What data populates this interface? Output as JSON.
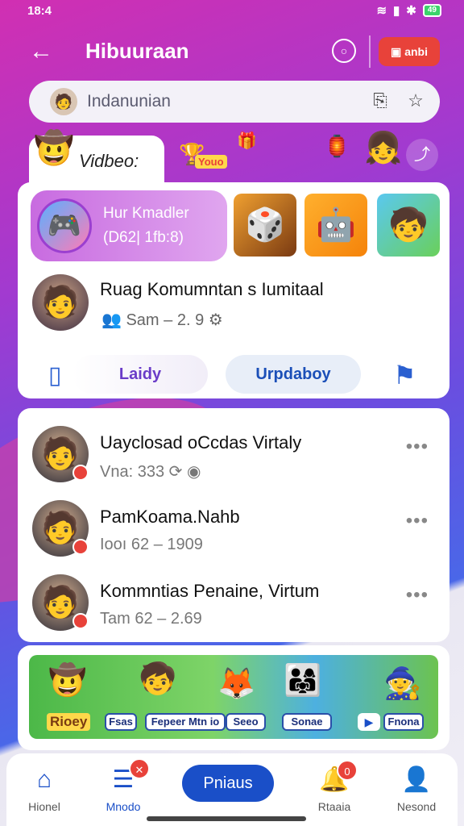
{
  "status": {
    "time": "18:4",
    "battery": "49"
  },
  "header": {
    "title": "Hibuuraan",
    "action_label": "anbi"
  },
  "search": {
    "placeholder": "Indanunian"
  },
  "tabs": {
    "video_label": "Vidbeo:",
    "badge": "Youo"
  },
  "featured": {
    "line1": "Hur Kmadler",
    "line2": "(D62| 1fb:8)"
  },
  "person": {
    "name": "Ruag Komumntan s Iumitaal",
    "sub": "Sam – 2. 9"
  },
  "actions": {
    "left": "Laidy",
    "right": "Urpdaboy"
  },
  "list": [
    {
      "title": "Uayclosad oCcdas Virtaly",
      "sub": "Vna:  333"
    },
    {
      "title": "PamKoama.Nahb",
      "sub": "Iooı  62 – 1909"
    },
    {
      "title": "Kommntias Penaine,      Virtum",
      "sub": "Tam  62 – 2.69"
    }
  ],
  "banner": {
    "logo": "Rioey",
    "buttons": [
      "Fsas",
      "Fepeer Mtn io",
      "Seeo",
      "Sonae",
      "Fnona"
    ]
  },
  "nav": {
    "items": [
      "Hionel",
      "Mnodo",
      "Rtaaia",
      "Nesond"
    ],
    "pill": "Pniaus",
    "badge": "0"
  },
  "colors": {
    "accent": "#1a4fc8",
    "alert": "#e8423a",
    "feature": "#c86be0"
  }
}
